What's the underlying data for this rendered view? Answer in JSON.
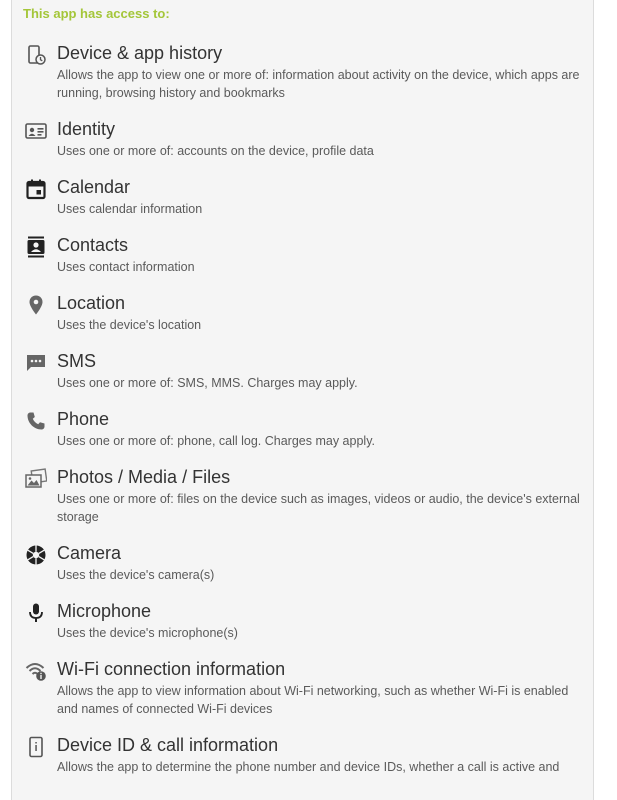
{
  "header": {
    "title": "This app has access to:",
    "color": "#a4c639"
  },
  "permissions": [
    {
      "icon": "device-history-icon",
      "title": "Device & app history",
      "description": "Allows the app to view one or more of: information about activity on the device, which apps are running, browsing history and bookmarks"
    },
    {
      "icon": "identity-icon",
      "title": "Identity",
      "description": "Uses one or more of: accounts on the device, profile data"
    },
    {
      "icon": "calendar-icon",
      "title": "Calendar",
      "description": "Uses calendar information"
    },
    {
      "icon": "contacts-icon",
      "title": "Contacts",
      "description": "Uses contact information"
    },
    {
      "icon": "location-icon",
      "title": "Location",
      "description": "Uses the device's location"
    },
    {
      "icon": "sms-icon",
      "title": "SMS",
      "description": "Uses one or more of: SMS, MMS. Charges may apply."
    },
    {
      "icon": "phone-icon",
      "title": "Phone",
      "description": "Uses one or more of: phone, call log. Charges may apply."
    },
    {
      "icon": "photos-media-icon",
      "title": "Photos / Media / Files",
      "description": "Uses one or more of: files on the device such as images, videos or audio, the device's external storage"
    },
    {
      "icon": "camera-icon",
      "title": "Camera",
      "description": "Uses the device's camera(s)"
    },
    {
      "icon": "microphone-icon",
      "title": "Microphone",
      "description": "Uses the device's microphone(s)"
    },
    {
      "icon": "wifi-info-icon",
      "title": "Wi-Fi connection information",
      "description": "Allows the app to view information about Wi-Fi networking, such as whether Wi-Fi is enabled and names of connected Wi-Fi devices"
    },
    {
      "icon": "device-id-icon",
      "title": "Device ID & call information",
      "description": "Allows the app to determine the phone number and device IDs, whether a call is active and"
    }
  ]
}
